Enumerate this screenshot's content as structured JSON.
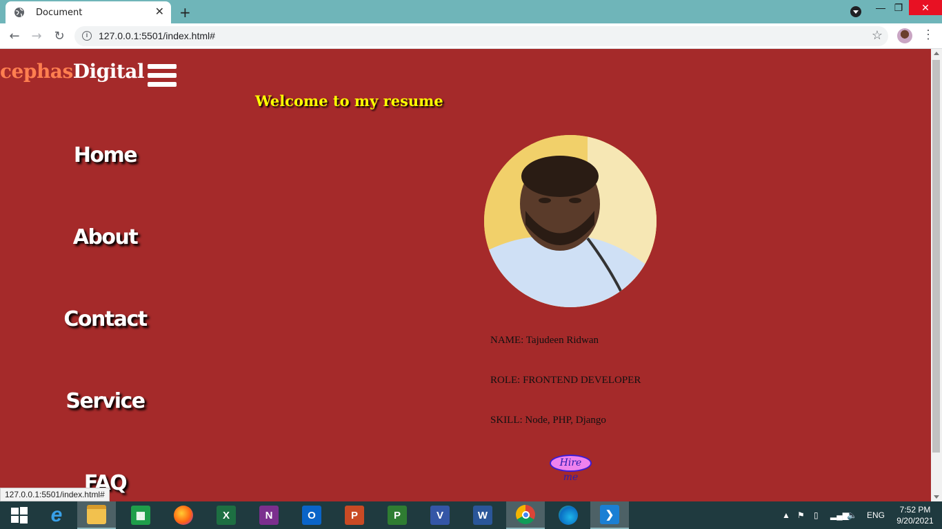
{
  "browser": {
    "tab_title": "Document",
    "tab_close": "✕",
    "new_tab": "+",
    "url": "127.0.0.1:5501/index.html#",
    "window_minimize": "—",
    "window_maximize": "❐",
    "window_close": "✕",
    "status_url": "127.0.0.1:5501/index.html#"
  },
  "site": {
    "logo_part1": "cephas",
    "logo_part2": "Digital",
    "welcome": "Welcome to my resume",
    "nav": [
      "Home",
      "About",
      "Contact",
      "Service",
      "FAQ"
    ],
    "profile": {
      "name": "NAME: Tajudeen Ridwan",
      "role": "ROLE: FRONTEND DEVELOPER",
      "skill": "SKILL: Node, PHP, Django"
    },
    "hire_button": "Hire me",
    "colors": {
      "background": "#a52a2a",
      "logo_accent": "#ff7f50",
      "welcome_text": "#ffff00",
      "hire_button": "#ee82ee"
    }
  },
  "taskbar": {
    "apps": [
      "start-icon",
      "internet-explorer-icon",
      "file-explorer-icon",
      "store-icon",
      "firefox-icon",
      "excel-icon",
      "onenote-icon",
      "outlook-icon",
      "powerpoint-icon",
      "project-icon",
      "visio-icon",
      "word-icon",
      "chrome-icon",
      "edge-icon",
      "vscode-icon"
    ],
    "language": "ENG",
    "time": "7:52 PM",
    "date": "9/20/2021"
  }
}
